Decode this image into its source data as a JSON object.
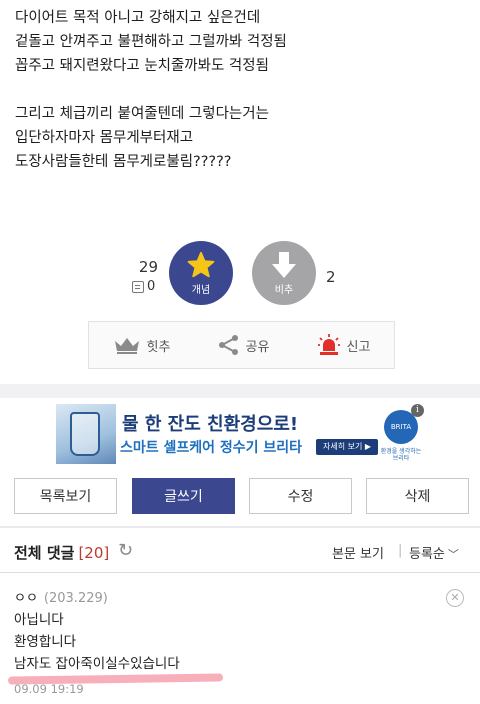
{
  "post": {
    "lines": [
      "다이어트 목적 아니고 강해지고 싶은건데",
      "겉돌고 안껴주고 불편해하고 그럴까봐 걱정됨",
      "꼽주고 돼지련왔다고 눈치줄까봐도 걱정됨",
      "",
      "그리고 체급끼리 붙여줄텐데 그렇다는거는",
      "입단하자마자 몸무게부터재고",
      "도장사람들한테 몸무게로불림?????"
    ]
  },
  "votes": {
    "up_count": "29",
    "memo_count": "0",
    "up_label": "개념",
    "down_label": "비추",
    "down_count": "2",
    "up_color": "#3b4890",
    "down_color": "#a5a5a8",
    "star_color": "#f5c518"
  },
  "actions": {
    "recommend": "힛추",
    "share": "공유",
    "report": "신고"
  },
  "ad": {
    "headline": "물 한 잔도 친환경으로!",
    "subline": "스마트 셀프케어 정수기 브리타",
    "more_label": "자세히 보기",
    "logo_text": "BRITA",
    "logo_caption": "환경을 생각하는 브리타"
  },
  "buttons": {
    "list": "목록보기",
    "write": "글쓰기",
    "edit": "수정",
    "delete": "삭제"
  },
  "comments_header": {
    "title": "전체 댓글",
    "count": "[20]",
    "view_body": "본문 보기",
    "sort": "등록순"
  },
  "comments": [
    {
      "author": "ㅇㅇ",
      "ip": "(203.229)",
      "lines": [
        "아닙니다",
        "환영합니다",
        "남자도 잡아죽이실수있습니다"
      ],
      "date": "09.09 19:19"
    }
  ]
}
